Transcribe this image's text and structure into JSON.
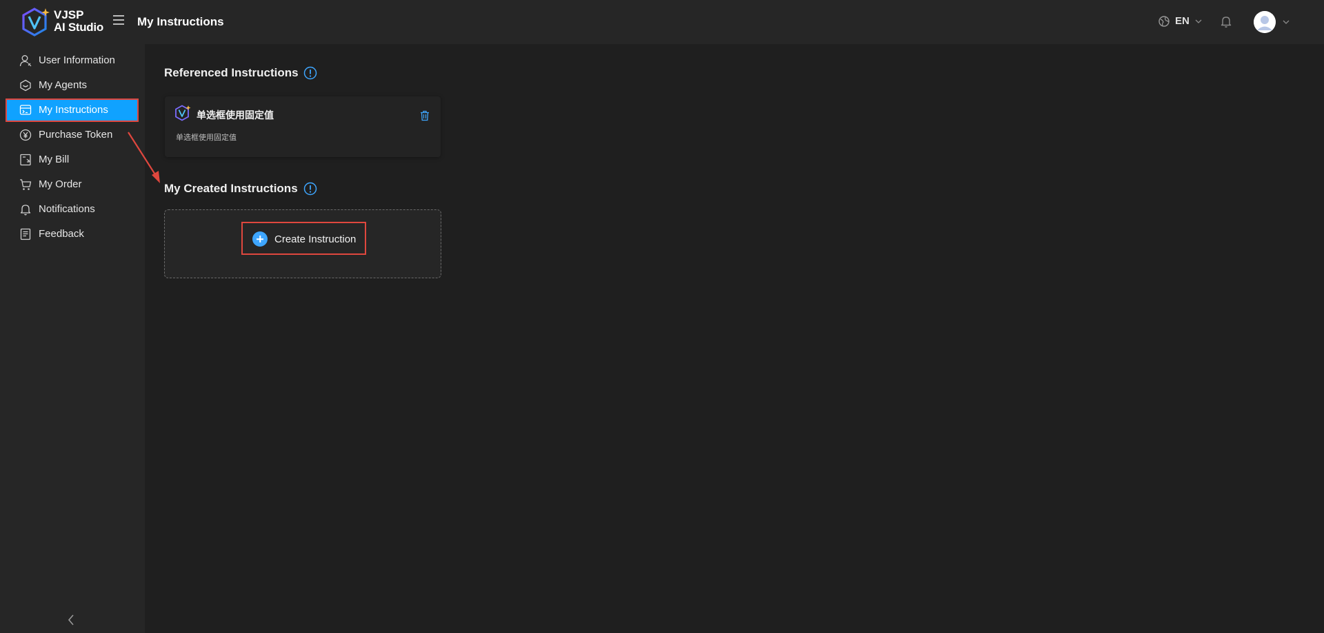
{
  "app": {
    "brand_line1": "VJSP",
    "brand_line2": "AI Studio"
  },
  "header": {
    "page_title": "My Instructions",
    "language": "EN"
  },
  "sidebar": {
    "items": [
      {
        "label": "User Information",
        "icon": "user-icon"
      },
      {
        "label": "My Agents",
        "icon": "agent-icon"
      },
      {
        "label": "My Instructions",
        "icon": "instructions-icon",
        "active": true
      },
      {
        "label": "Purchase Token",
        "icon": "yen-icon"
      },
      {
        "label": "My Bill",
        "icon": "bill-icon"
      },
      {
        "label": "My Order",
        "icon": "cart-icon"
      },
      {
        "label": "Notifications",
        "icon": "bell-icon"
      },
      {
        "label": "Feedback",
        "icon": "feedback-icon"
      }
    ]
  },
  "main": {
    "referenced": {
      "title": "Referenced Instructions",
      "cards": [
        {
          "name": "单选框使用固定值",
          "description": "单选框使用固定值"
        }
      ]
    },
    "created": {
      "title": "My Created Instructions",
      "create_label": "Create Instruction"
    }
  },
  "colors": {
    "accent": "#10a2ff",
    "highlight_border": "#e0473e",
    "background": "#1f1f1f",
    "panel": "#262626"
  }
}
